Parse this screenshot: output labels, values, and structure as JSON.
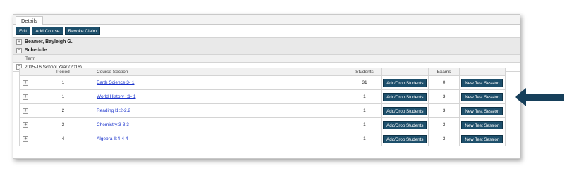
{
  "tab": "Details",
  "toolbar": {
    "edit": "Edit",
    "add_course": "Add Course",
    "revoke_claim": "Revoke Claim"
  },
  "sections": {
    "student": "Beamer, Bayleigh G.",
    "schedule": "Schedule"
  },
  "term": {
    "header": "Term",
    "value": "2015-16 School Year (2016)"
  },
  "columns": {
    "period": "Period",
    "course_section": "Course Section",
    "students": "Students",
    "exams": "Exams"
  },
  "rows": [
    {
      "period": "1",
      "course": "Earth Science:3- 1",
      "students": "31",
      "exams": "0"
    },
    {
      "period": "1",
      "course": "World History I:1- 1",
      "students": "1",
      "exams": "3"
    },
    {
      "period": "2",
      "course": "Reading I1:2-2.2",
      "students": "1",
      "exams": "3"
    },
    {
      "period": "3",
      "course": "Chemistry:3-3 3",
      "students": "1",
      "exams": "3"
    },
    {
      "period": "4",
      "course": "Algebra II:4-4 4",
      "students": "1",
      "exams": "3"
    }
  ],
  "row_buttons": {
    "add_drop": "Add/Drop Students",
    "new_test": "New Test Session"
  },
  "icons": {
    "expand": "+",
    "collapse": "−"
  },
  "colors": {
    "button": "#1d4f6b",
    "arrow": "#163f5a",
    "link": "#1a33cc"
  }
}
